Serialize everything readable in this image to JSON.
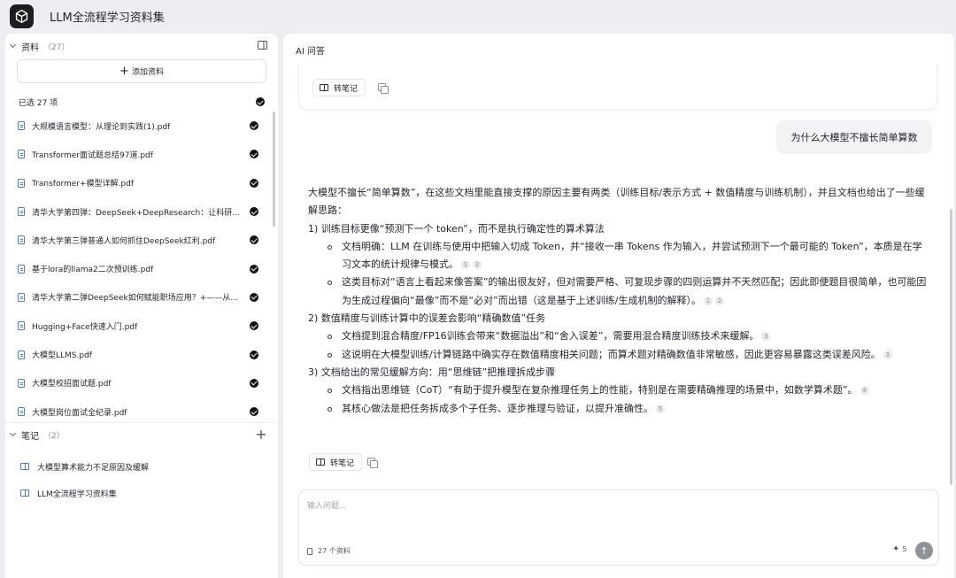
{
  "app": {
    "title": "LLM全流程学习资料集"
  },
  "sources": {
    "header": "资料",
    "count": "（27）",
    "add_label": "添加资料",
    "selected_label": "已选 27 项",
    "files": [
      "大规模语言模型：从理论到实践(1).pdf",
      "Transformer面试题总结97道.pdf",
      "Transformer+模型详解.pdf",
      "清华大学第四弹：DeepSeek+DeepResearch：让科研像聊天一样简单.pdf",
      "清华大学第三弹普通人如何抓住DeepSeek红利.pdf",
      "基于lora的llama2二次预训练.pdf",
      "清华大学第二弹DeepSeek如何赋能职场应用？+——从提示语技巧到多场景应用.pdf",
      "Hugging+Face快速入门.pdf",
      "大模型LLMS.pdf",
      "大模型校招面试题.pdf",
      "大模型岗位面试全纪录.pdf"
    ]
  },
  "notes": {
    "header": "笔记",
    "count": "（2）",
    "items": [
      "大模型算术能力不足原因及缓解",
      "LLM全流程学习资料集"
    ]
  },
  "chat": {
    "title": "AI 问答",
    "to_note_label": "转笔记",
    "question": "为什么大模型不擅长简单算数",
    "answer": {
      "intro": "大模型不擅长“简单算数”，在这些文档里能直接支撑的原因主要有两类（训练目标/表示方式 + 数值精度与训练机制），并且文档也给出了一些缓解思路：",
      "s1": "1) 训练目标更像“预测下一个 token”，而不是执行确定性的算术算法",
      "s1a": "文档明确：LLM 在训练与使用中把输入切成 Token，并“接收一串 Tokens 作为输入，并尝试预测下一个最可能的 Token”，本质是在学习文本的统计规律与模式。",
      "s1b": "这类目标对“语言上看起来像答案”的输出很友好，但对需要严格、可复现步骤的四则运算并不天然匹配；因此即便题目很简单，也可能因为生成过程偏向“最像”而不是“必对”而出错（这是基于上述训练/生成机制的解释）。",
      "s2": "2) 数值精度与训练计算中的误差会影响“精确数值”任务",
      "s2a": "文档提到混合精度/FP16训练会带来“数据溢出”和“舍入误差”，需要用混合精度训练技术来缓解。",
      "s2b": "这说明在大模型训练/计算链路中确实存在数值精度相关问题；而算术题对精确数值非常敏感，因此更容易暴露这类误差风险。",
      "s3": "3) 文档给出的常见缓解方向：用“思维链”把推理拆成步骤",
      "s3a": "文档指出思维链（CoT）“有助于提升模型在复杂推理任务上的性能，特别是在需要精确推理的场景中，如数学算术题”。",
      "s3b": "其核心做法是把任务拆成多个子任务、逐步推理与验证，以提升准确性。",
      "cites": [
        "1",
        "2",
        "3",
        "4",
        "5"
      ]
    }
  },
  "input": {
    "placeholder": "输入问题...",
    "source_count": "27 个资料",
    "model_label": "5",
    "send_icon": "arrow-up-icon"
  },
  "colors": {
    "accent": "#4a7bd0",
    "panel": "#ffffff",
    "bg": "#eceef1"
  }
}
